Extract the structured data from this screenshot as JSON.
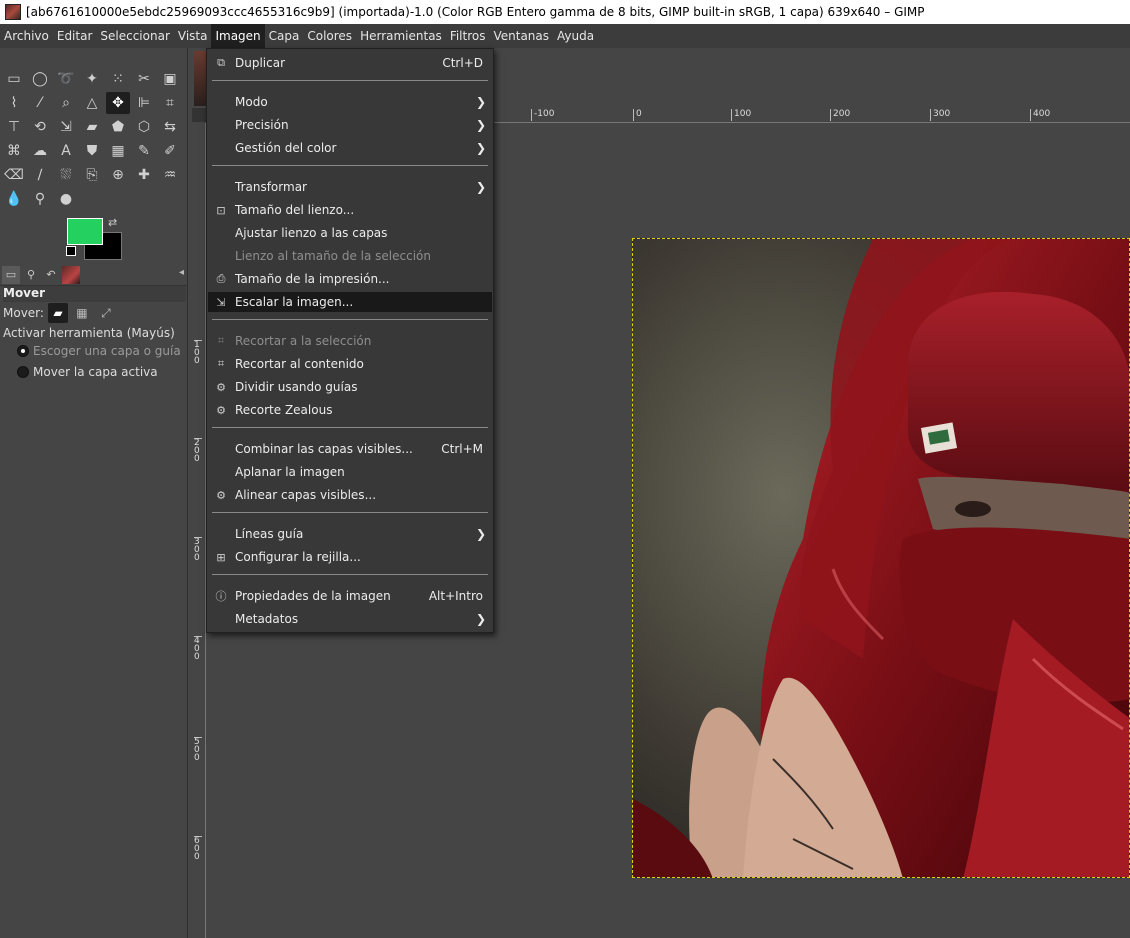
{
  "window": {
    "title": "[ab6761610000e5ebdc25969093ccc4655316c9b9] (importada)-1.0 (Color RGB Entero gamma de 8 bits, GIMP built-in sRGB, 1 capa) 639x640 – GIMP"
  },
  "menubar": {
    "items": [
      "Archivo",
      "Editar",
      "Seleccionar",
      "Vista",
      "Imagen",
      "Capa",
      "Colores",
      "Herramientas",
      "Filtros",
      "Ventanas",
      "Ayuda"
    ],
    "active": "Imagen"
  },
  "colors": {
    "foreground": "#23d060",
    "background": "#000000",
    "selection_border": "#e0d200"
  },
  "tool_options": {
    "title": "Mover",
    "mover_label": "Mover:",
    "toggle_label": "Activar herramienta  (Mayús)",
    "option_pick": "Escoger una capa o guía",
    "option_active": "Mover la capa activa"
  },
  "rulers": {
    "top": [
      "-100",
      "0",
      "100",
      "200",
      "300",
      "400"
    ],
    "left": [
      "100",
      "200",
      "300",
      "400",
      "500",
      "600"
    ]
  },
  "image_menu": {
    "duplicate": {
      "label": "Duplicar",
      "shortcut": "Ctrl+D"
    },
    "mode": {
      "label": "Modo"
    },
    "precision": {
      "label": "Precisión"
    },
    "color_management": {
      "label": "Gestión del color"
    },
    "transform": {
      "label": "Transformar"
    },
    "canvas_size": {
      "label": "Tamaño del lienzo..."
    },
    "fit_canvas_layers": {
      "label": "Ajustar lienzo a las capas"
    },
    "canvas_to_selection": {
      "label": "Lienzo al tamaño de la selección"
    },
    "print_size": {
      "label": "Tamaño de la impresión..."
    },
    "scale_image": {
      "label": "Escalar la imagen..."
    },
    "crop_to_selection": {
      "label": "Recortar a la selección"
    },
    "crop_to_content": {
      "label": "Recortar al contenido"
    },
    "slice_guides": {
      "label": "Dividir usando guías"
    },
    "zealous_crop": {
      "label": "Recorte Zealous"
    },
    "merge_visible": {
      "label": "Combinar las capas visibles...",
      "shortcut": "Ctrl+M"
    },
    "flatten": {
      "label": "Aplanar la imagen"
    },
    "align_layers": {
      "label": "Alinear capas visibles..."
    },
    "guides": {
      "label": "Líneas guía"
    },
    "grid": {
      "label": "Configurar la rejilla..."
    },
    "properties": {
      "label": "Propiedades de la imagen",
      "shortcut": "Alt+Intro"
    },
    "metadata": {
      "label": "Metadatos"
    }
  }
}
